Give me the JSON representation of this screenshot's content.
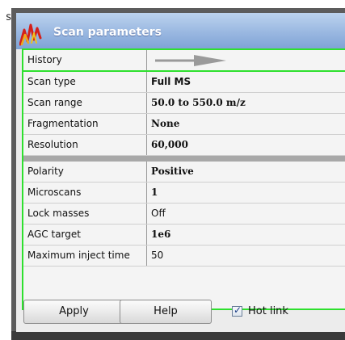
{
  "edge_text": "s",
  "window": {
    "title": "Scan parameters",
    "logo_icon": "orbitrap-peaks-logo"
  },
  "rows": [
    {
      "label": "History",
      "value": ""
    },
    {
      "label": "Scan type",
      "value": "Full MS"
    },
    {
      "label": "Scan range",
      "value": "50.0 to 550.0 m/z"
    },
    {
      "label": "Fragmentation",
      "value": "None"
    },
    {
      "label": "Resolution",
      "value": "60,000"
    },
    {
      "label": "Polarity",
      "value": "Positive"
    },
    {
      "label": "Microscans",
      "value": "1"
    },
    {
      "label": "Lock masses",
      "value": "Off"
    },
    {
      "label": "AGC target",
      "value": "1e6"
    },
    {
      "label": "Maximum inject time",
      "value": "50"
    }
  ],
  "history_icon": "arrow-right-icon",
  "buttons": {
    "apply_label": "Apply",
    "help_label": "Help"
  },
  "hot_link": {
    "label": "Hot link",
    "checked": true
  },
  "colors": {
    "selection_border": "#2ee02e",
    "title_bar": "#8fb0dc",
    "separator": "#a8a8a8"
  }
}
